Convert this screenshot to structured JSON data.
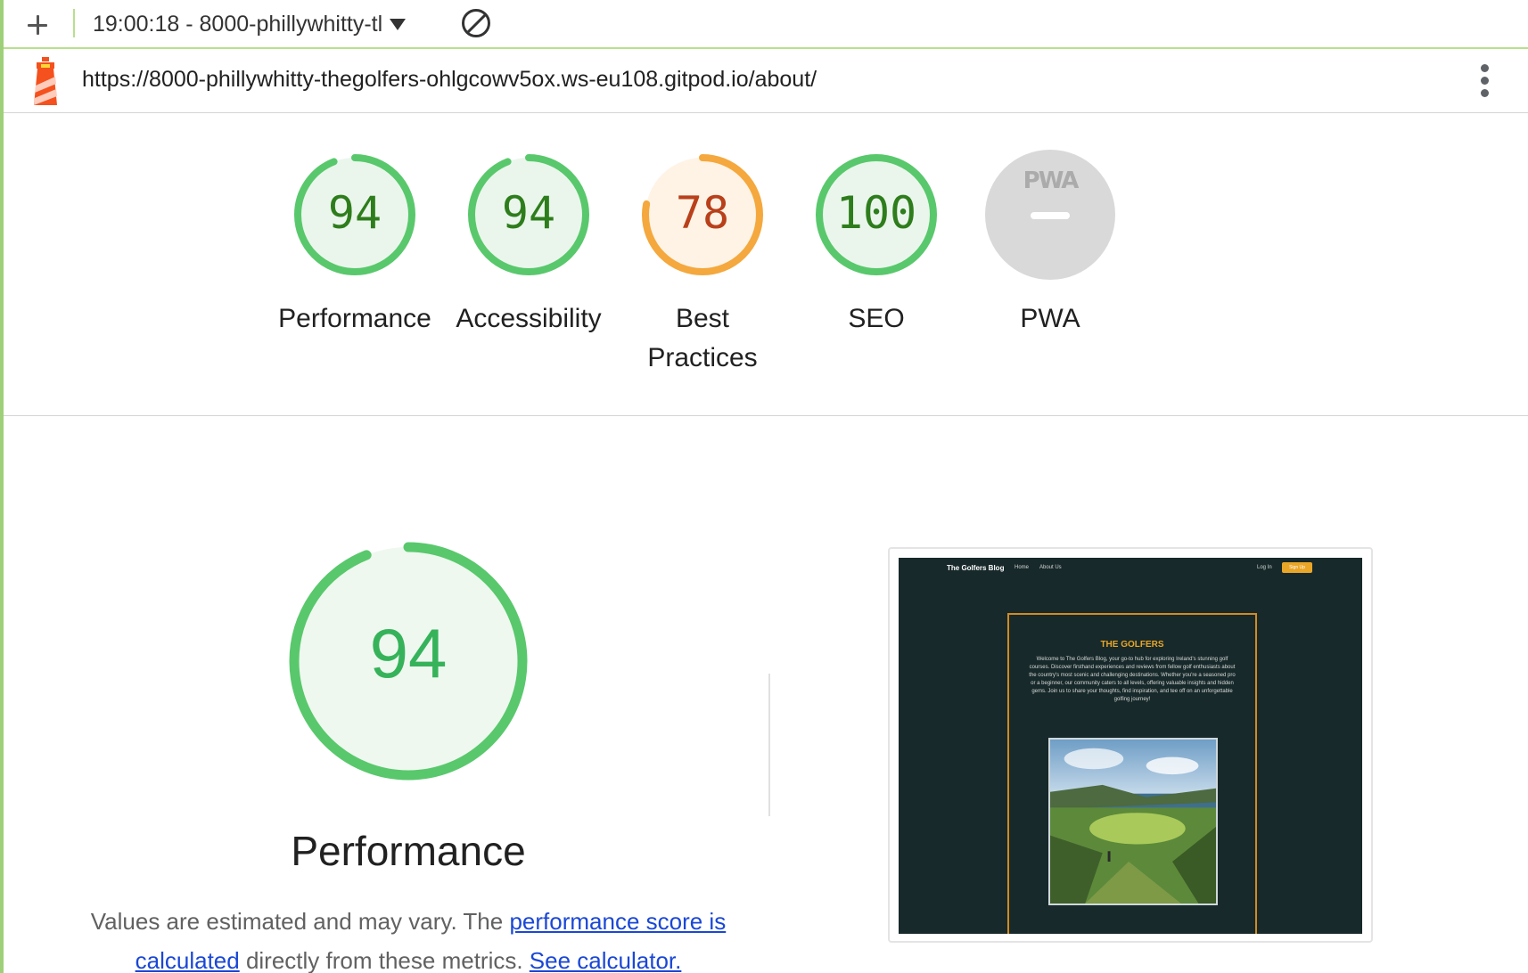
{
  "toolbar": {
    "add_label": "+",
    "report_select": "19:00:18 - 8000-phillywhitty-tl",
    "clear_label": "clear"
  },
  "urlbar": {
    "url": "https://8000-phillywhitty-thegolfers-ohlgcowv5ox.ws-eu108.gitpod.io/about/"
  },
  "colors": {
    "pass": "#0cce6b",
    "pass_text": "#008800",
    "average": "#ffa400",
    "average_text": "#c33300",
    "na": "#d9d9d9"
  },
  "scores": [
    {
      "label": "Performance",
      "value": "94",
      "fraction": 0.94,
      "status": "pass"
    },
    {
      "label": "Accessibility",
      "value": "94",
      "fraction": 0.94,
      "status": "pass"
    },
    {
      "label": "Best Practices",
      "value": "78",
      "fraction": 0.78,
      "status": "average"
    },
    {
      "label": "SEO",
      "value": "100",
      "fraction": 1.0,
      "status": "pass"
    },
    {
      "label": "PWA",
      "value": "PWA",
      "fraction": 0,
      "status": "na"
    }
  ],
  "main": {
    "score": "94",
    "fraction": 0.94,
    "title": "Performance",
    "desc_prefix": "Values are estimated and may vary. The ",
    "link_score": "performance score is calculated",
    "desc_middle": " directly from these metrics. ",
    "link_calc": "See calculator."
  },
  "screenshot": {
    "brand": "The Golfers Blog",
    "nav": [
      "Home",
      "About Us"
    ],
    "login": "Log In",
    "signup": "Sign Up",
    "title": "THE GOLFERS",
    "text": "Welcome to The Golfers Blog, your go-to hub for exploring Ireland's stunning golf courses. Discover firsthand experiences and reviews from fellow golf enthusiasts about the country's most scenic and challenging destinations. Whether you're a seasoned pro or a beginner, our community caters to all levels, offering valuable insights and hidden gems. Join us to share your thoughts, find inspiration, and tee off on an unforgettable golfing journey!"
  }
}
